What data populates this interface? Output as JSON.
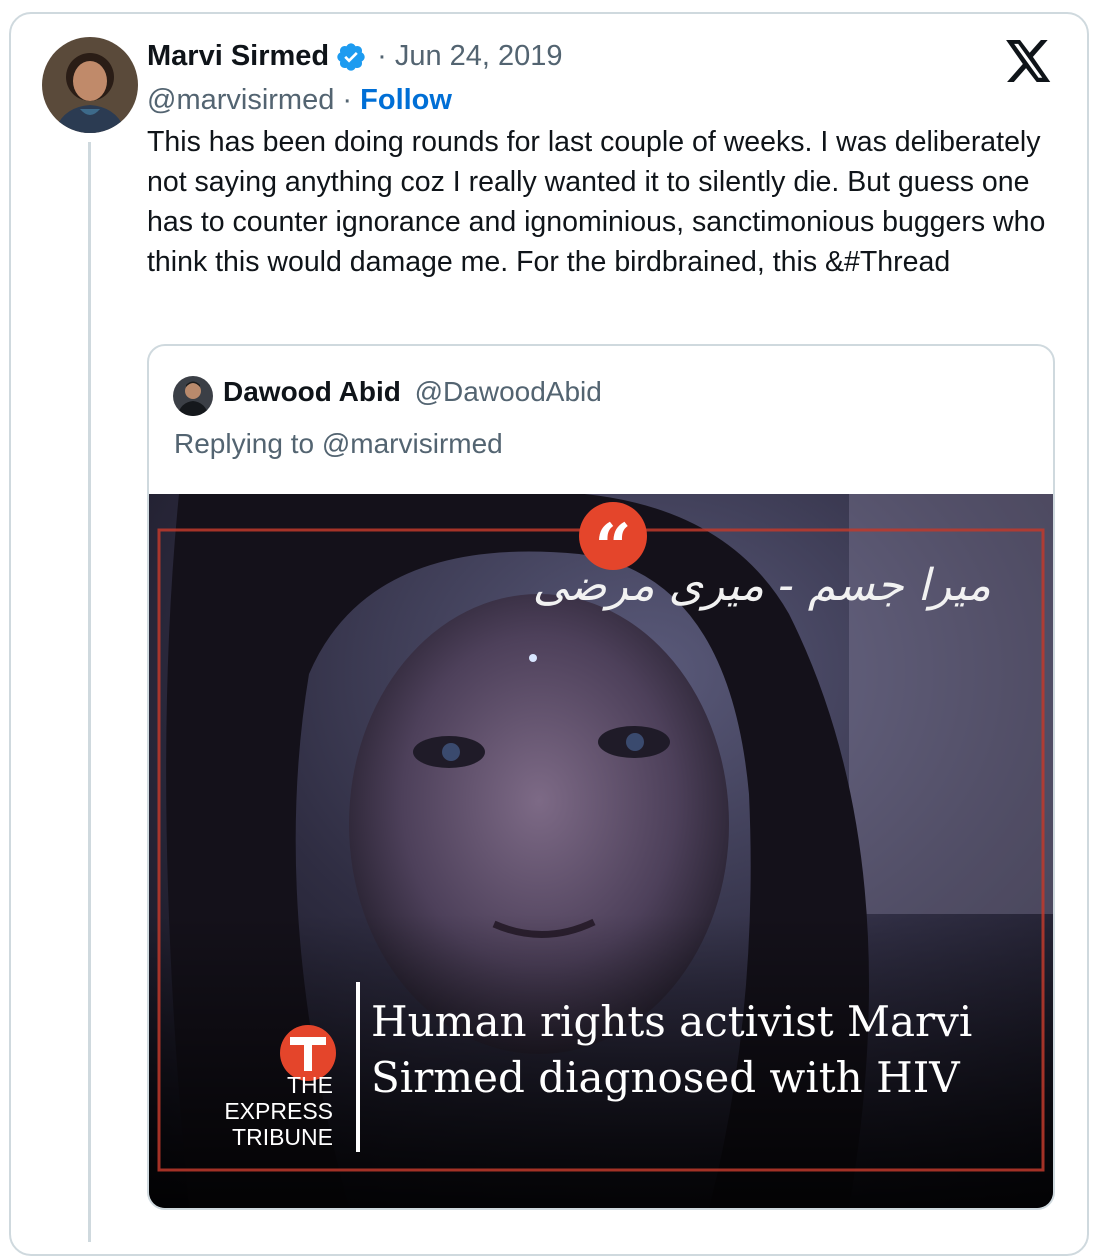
{
  "tweet": {
    "author_name": "Marvi Sirmed",
    "verified": true,
    "date": "Jun 24, 2019",
    "handle": "@marvisirmed",
    "separator": "·",
    "follow_label": "Follow",
    "text": "This has been doing rounds for last couple of weeks. I was deliberately not saying anything coz I really wanted it to silently die. But guess one has to counter ignorance and ignominious, sanctimonious buggers who think this would damage me. For the birdbrained, this &#Thread"
  },
  "quoted_tweet": {
    "author_name": "Dawood Abid",
    "handle": "@DawoodAbid",
    "replying_to": "Replying to @marvisirmed",
    "media": {
      "urdu_caption": "میرا جسم - میری مرضی",
      "publisher_line1": "THE",
      "publisher_line2": "EXPRESS",
      "publisher_line3": "TRIBUNE",
      "headline": "Human rights activist Marvi Sirmed diagnosed with HIV"
    }
  },
  "colors": {
    "link_blue": "#006fd6",
    "verified_blue": "#1d9bf0",
    "secondary_text": "#536471",
    "accent_red": "#e4452b"
  },
  "icons": [
    "verified-badge-icon",
    "x-logo-icon",
    "quote-mark-icon",
    "express-tribune-logo-icon"
  ]
}
